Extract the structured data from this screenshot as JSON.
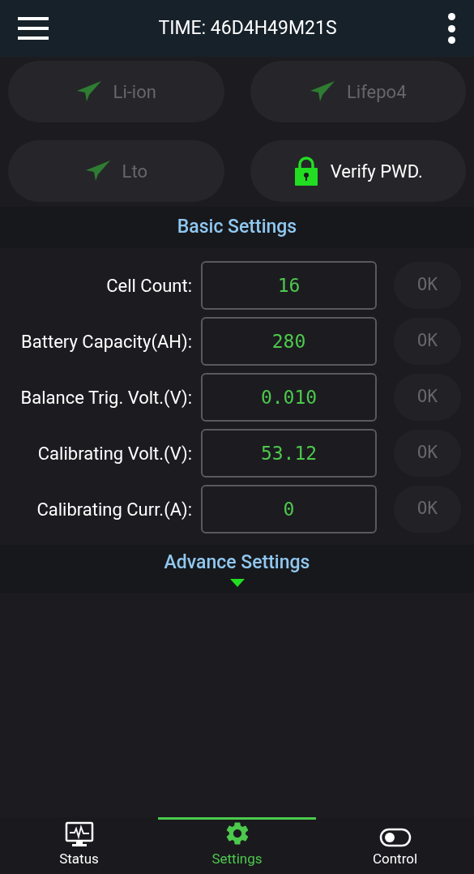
{
  "header": {
    "title": "TIME: 46D4H49M21S"
  },
  "type_buttons": [
    {
      "kind": "battery",
      "label": "Li-ion",
      "disabled": true
    },
    {
      "kind": "battery",
      "label": "Lifepo4",
      "disabled": true
    },
    {
      "kind": "battery",
      "label": "Lto",
      "disabled": true
    },
    {
      "kind": "verify",
      "label": "Verify PWD.",
      "disabled": false
    }
  ],
  "basic_settings": {
    "title": "Basic Settings",
    "rows": [
      {
        "label": "Cell Count:",
        "value": "16",
        "ok": "OK",
        "ok_disabled": true
      },
      {
        "label": "Battery Capacity(AH):",
        "value": "280",
        "ok": "OK",
        "ok_disabled": true
      },
      {
        "label": "Balance Trig. Volt.(V):",
        "value": "0.010",
        "ok": "OK",
        "ok_disabled": true
      },
      {
        "label": "Calibrating Volt.(V):",
        "value": "53.12",
        "ok": "OK",
        "ok_disabled": true
      },
      {
        "label": "Calibrating Curr.(A):",
        "value": "0",
        "ok": "OK",
        "ok_disabled": true
      }
    ]
  },
  "advance_settings": {
    "title": "Advance Settings",
    "expanded": false
  },
  "nav": [
    {
      "kind": "status",
      "label": "Status",
      "selected": false
    },
    {
      "kind": "settings",
      "label": "Settings",
      "selected": true
    },
    {
      "kind": "control",
      "label": "Control",
      "selected": false
    }
  ]
}
